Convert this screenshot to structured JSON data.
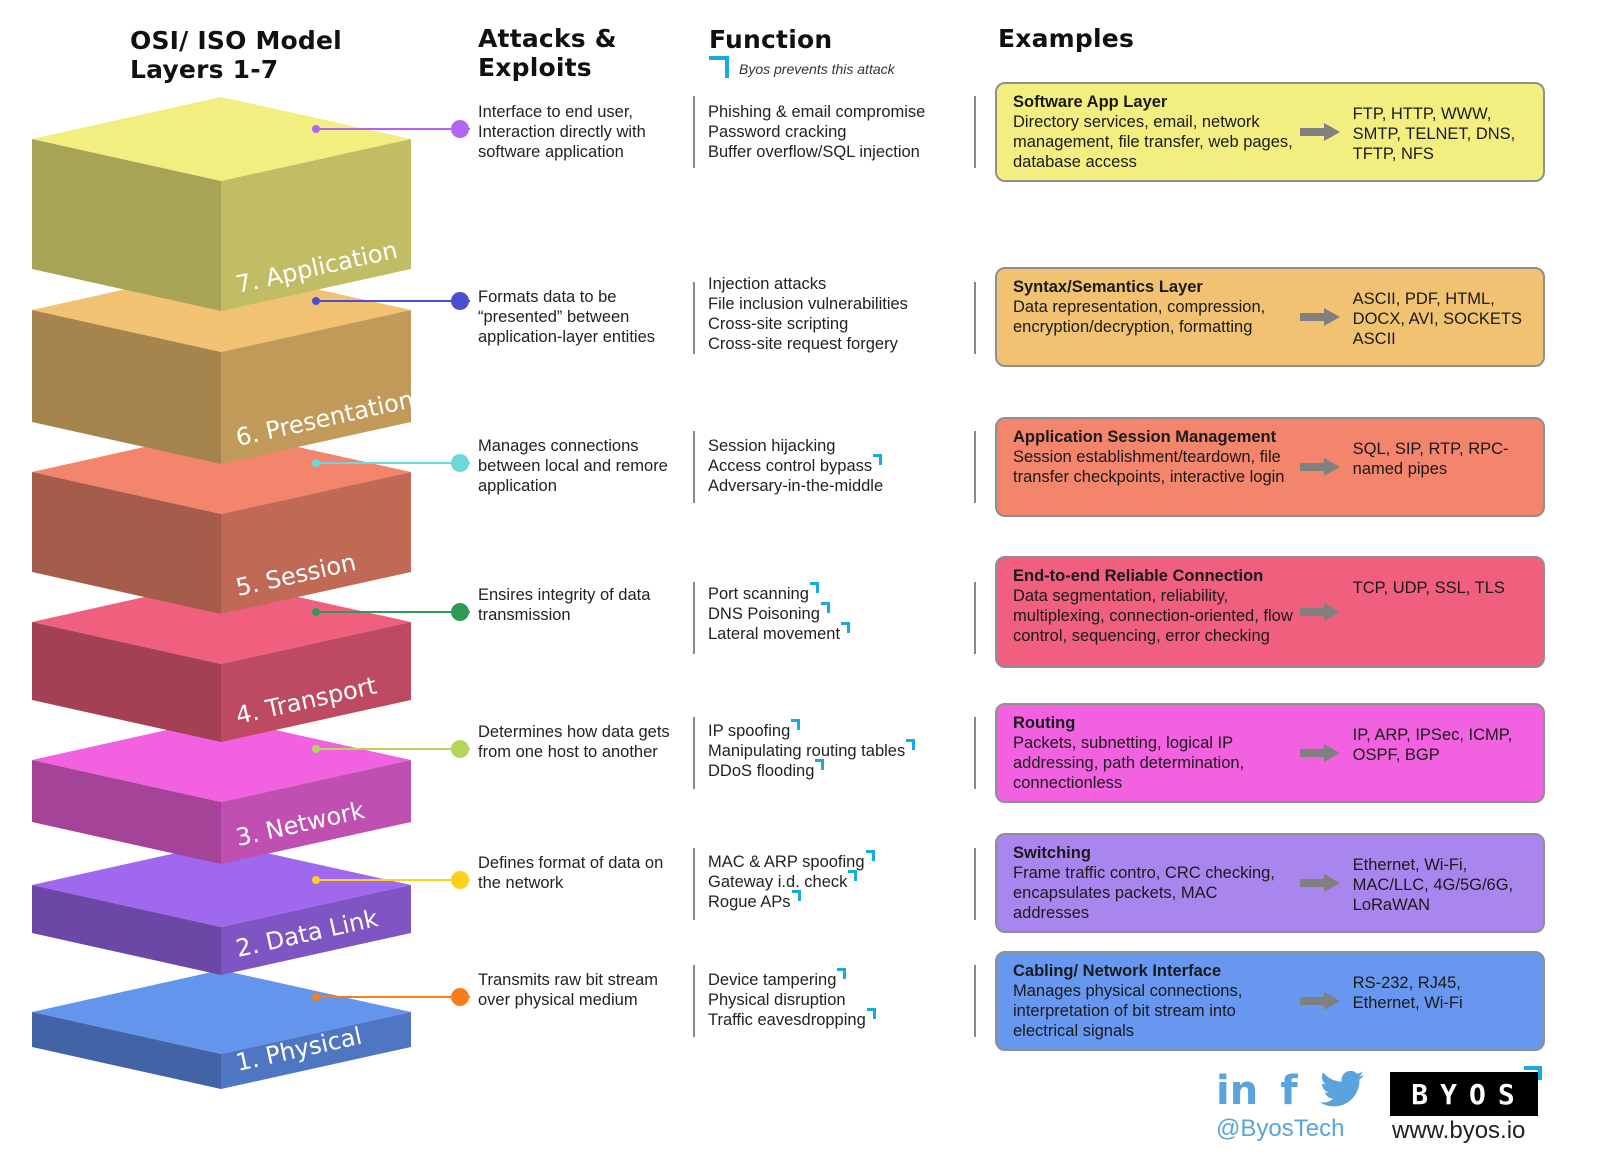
{
  "headers": {
    "model_line1": "OSI/ ISO Model",
    "model_line2": "Layers 1-7",
    "attacks_line1": "Attacks &",
    "attacks_line2": "Exploits",
    "function": "Function",
    "examples": "Examples"
  },
  "legend": {
    "icon": "byos-corner-mark-icon",
    "label": "Byos prevents this attack",
    "mark_color": "#17a9e1"
  },
  "layers": [
    {
      "label": "7. Application",
      "colors": {
        "top": "#f2ef80",
        "left": "#a8a456",
        "right": "#c1bd64"
      },
      "dot_color": "#b066f2",
      "function": "Interface to end user, Interaction directly with software application",
      "attacks": [
        {
          "text": "Phishing & email compromise",
          "prevented": false
        },
        {
          "text": "Password cracking",
          "prevented": false
        },
        {
          "text": "Buffer overflow/SQL injection",
          "prevented": false
        }
      ],
      "box": {
        "color": "#f2ef80",
        "title": "Software App Layer",
        "description": "Directory services, email, network management, file transfer, web pages, database access",
        "examples": "FTP, HTTP, WWW, SMTP, TELNET, DNS, TFTP, NFS"
      }
    },
    {
      "label": "6. Presentation",
      "colors": {
        "top": "#f1c271",
        "left": "#a5854d",
        "right": "#c19a5a"
      },
      "dot_color": "#4a4fcf",
      "function": "Formats data to be “presented” between application-layer entities",
      "attacks": [
        {
          "text": "Injection attacks",
          "prevented": false
        },
        {
          "text": "File inclusion vulnerabilities",
          "prevented": false
        },
        {
          "text": "Cross-site scripting",
          "prevented": false
        },
        {
          "text": "Cross-site request forgery",
          "prevented": false
        }
      ],
      "box": {
        "color": "#f1c271",
        "title": "Syntax/Semantics Layer",
        "description": "Data representation, compression, encryption/decryption, formatting",
        "examples": "ASCII, PDF, HTML, DOCX, AVI, SOCKETS ASCII"
      }
    },
    {
      "label": "5. Session",
      "colors": {
        "top": "#f2856c",
        "left": "#a55c4a",
        "right": "#c06a56"
      },
      "dot_color": "#6dd8dc",
      "function": "Manages connections between local and remore application",
      "attacks": [
        {
          "text": "Session hijacking",
          "prevented": false
        },
        {
          "text": "Access control bypass",
          "prevented": true
        },
        {
          "text": "Adversary-in-the-middle",
          "prevented": false
        }
      ],
      "box": {
        "color": "#f2856c",
        "title": "Application Session Management",
        "description": "Session establishment/teardown, file transfer checkpoints, interactive login",
        "examples": "SQL, SIP, RTP, RPC-named pipes"
      }
    },
    {
      "label": "4. Transport",
      "colors": {
        "top": "#f05f7d",
        "left": "#a34054",
        "right": "#be4a62"
      },
      "dot_color": "#2e9a55",
      "function": "Ensires integrity of data transmission",
      "attacks": [
        {
          "text": "Port scanning",
          "prevented": true
        },
        {
          "text": "DNS Poisoning",
          "prevented": true
        },
        {
          "text": "Lateral movement",
          "prevented": true
        }
      ],
      "box": {
        "color": "#f05f7d",
        "title": "End-to-end Reliable Connection",
        "description": "Data segmentation, reliability, multiplexing, connection-oriented, flow control, sequencing, error checking",
        "examples": "TCP, UDP, SSL, TLS"
      }
    },
    {
      "label": "3. Network",
      "colors": {
        "top": "#f262e0",
        "left": "#a54398",
        "right": "#c04fb2"
      },
      "dot_color": "#b5d45a",
      "function": "Determines how data gets from one host to another",
      "attacks": [
        {
          "text": "IP spoofing",
          "prevented": true
        },
        {
          "text": "Manipulating routing tables",
          "prevented": true
        },
        {
          "text": "DDoS flooding",
          "prevented": true
        }
      ],
      "box": {
        "color": "#f262e0",
        "title": "Routing",
        "description": "Packets, subnetting, logical IP addressing, path determination, connectionless",
        "examples": "IP, ARP, IPSec, ICMP, OSPF, BGP"
      }
    },
    {
      "label": "2. Data Link",
      "colors": {
        "top": "#a068ef",
        "left": "#6b48a6",
        "right": "#7e55c2"
      },
      "dot_color": "#ffd21a",
      "function": "Defines format of data on the network",
      "attacks": [
        {
          "text": "MAC & ARP spoofing",
          "prevented": true
        },
        {
          "text": "Gateway i.d. check",
          "prevented": true
        },
        {
          "text": "Rogue APs",
          "prevented": true
        }
      ],
      "box": {
        "color": "#a986ee",
        "title": "Switching",
        "description": "Frame traffic contro, CRC checking, encapsulates packets, MAC addresses",
        "examples": "Ethernet, Wi-Fi, MAC/LLC, 4G/5G/6G, LoRaWAN"
      }
    },
    {
      "label": "1. Physical",
      "colors": {
        "top": "#6495ec",
        "left": "#4263a5",
        "right": "#4e76c2"
      },
      "dot_color": "#f77d1a",
      "function": "Transmits raw bit stream over physical medium",
      "attacks": [
        {
          "text": "Device tampering",
          "prevented": true
        },
        {
          "text": "Physical disruption",
          "prevented": false
        },
        {
          "text": "Traffic eavesdropping",
          "prevented": true
        }
      ],
      "box": {
        "color": "#6797ef",
        "title": "Cabling/ Network Interface",
        "description": "Manages physical connections, interpretation of bit stream into electrical signals",
        "examples": "RS-232, RJ45, Ethernet, Wi-Fi"
      }
    }
  ],
  "footer": {
    "social": [
      {
        "icon": "linkedin-icon",
        "glyph": "in"
      },
      {
        "icon": "facebook-icon",
        "glyph": "f"
      },
      {
        "icon": "twitter-icon",
        "glyph": "🐦"
      }
    ],
    "handle": "@ByosTech",
    "logo": "BYOS",
    "url": "www.byos.io",
    "social_color": "#5ba3dc"
  }
}
